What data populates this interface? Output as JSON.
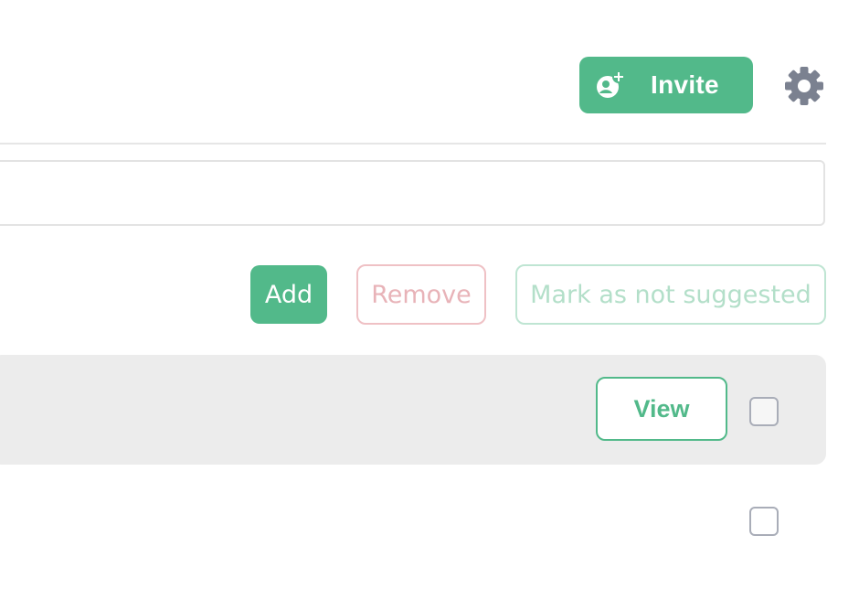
{
  "header": {
    "invite_label": "Invite",
    "invite_icon": "add-user-icon",
    "settings_icon": "gear-icon"
  },
  "search": {
    "value": "",
    "placeholder": ""
  },
  "actions": {
    "add_label": "Add",
    "remove_label": "Remove",
    "mark_label": "Mark as not suggested"
  },
  "rows": [
    {
      "view_label": "View",
      "checked": false
    },
    {
      "checked": false
    }
  ],
  "colors": {
    "accent": "#52b98a",
    "danger_muted": "#e8b3b8",
    "accent_muted": "#b3dfc9",
    "row_highlight": "#ececec",
    "icon_gray": "#7b8190"
  }
}
